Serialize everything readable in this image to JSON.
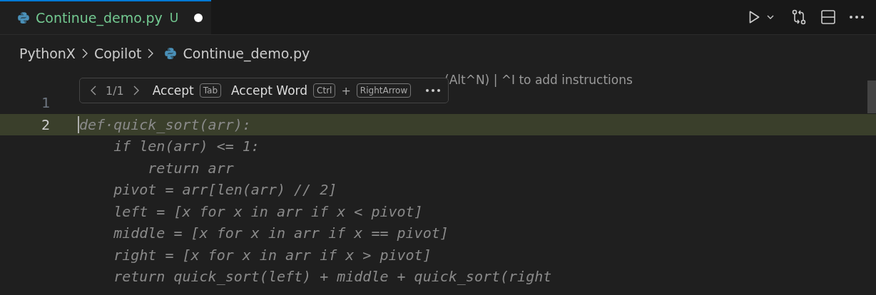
{
  "tabs": [
    {
      "label": "Continue_demo.py",
      "status": "U",
      "modified": true,
      "selected": true
    }
  ],
  "toolbar": [
    {
      "kind": "run"
    },
    {
      "kind": "dropdown"
    },
    {
      "kind": "compare"
    },
    {
      "kind": "split"
    },
    {
      "kind": "more"
    }
  ],
  "breadcrumbs": [
    {
      "label": "PythonX",
      "kind": "folder"
    },
    {
      "label": "Copilot",
      "kind": "folder"
    },
    {
      "label": "Continue_demo.py",
      "kind": "file"
    }
  ],
  "codelens": "(Alt^N) | ^I to add instructions",
  "suggestion_widget": {
    "counter": "1/1",
    "accept": "Accept",
    "accept_key": "Tab",
    "accept_word": "Accept Word",
    "word_keys": [
      "Ctrl",
      "RightArrow"
    ],
    "plus": "+"
  },
  "lines": [
    {
      "number": "1",
      "current": false
    },
    {
      "number": "2",
      "text": "def·quick_sort(arr):",
      "current": true
    },
    {
      "text": "    if len(arr) <= 1:",
      "current": false
    },
    {
      "text": "        return arr",
      "current": false
    },
    {
      "text": "    pivot = arr[len(arr) // 2]",
      "current": false
    },
    {
      "text": "    left = [x for x in arr if x < pivot]",
      "current": false
    },
    {
      "text": "    middle = [x for x in arr if x == pivot]",
      "current": false
    },
    {
      "text": "    right = [x for x in arr if x > pivot]",
      "current": false
    },
    {
      "text": "    return quick_sort(left) + middle + quick_sort(right",
      "current": false
    }
  ]
}
